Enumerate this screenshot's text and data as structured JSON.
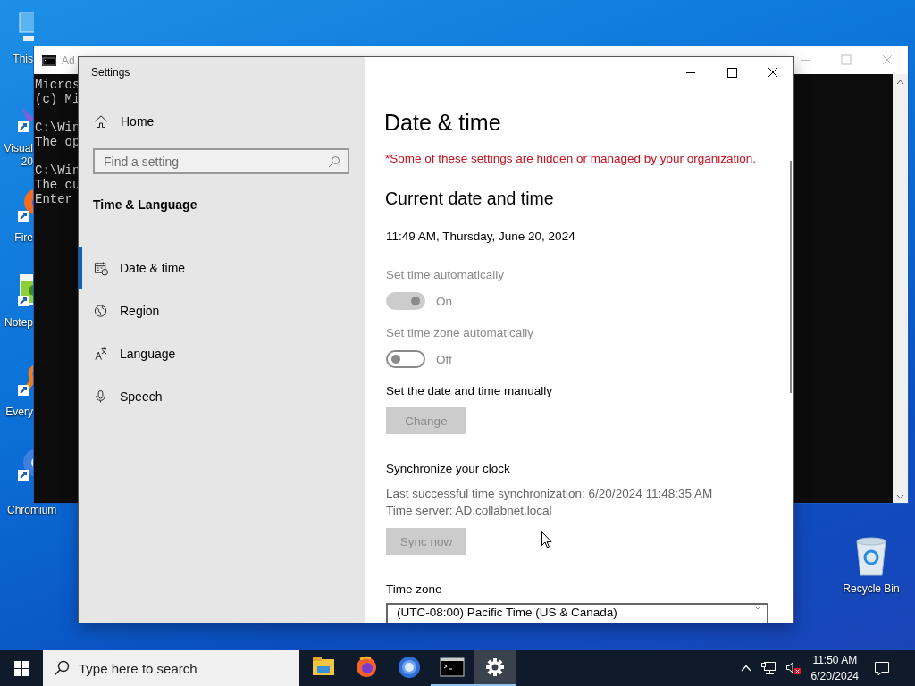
{
  "desktop_icons": [
    {
      "kind": "computer",
      "label": "This"
    },
    {
      "kind": "studio",
      "label": "Visual 20"
    },
    {
      "kind": "firefox",
      "label": "Fire"
    },
    {
      "kind": "notepad",
      "label": "Notep"
    },
    {
      "kind": "everything",
      "label": "Every"
    },
    {
      "kind": "chromium",
      "label": "Chromium"
    }
  ],
  "recycle_bin": {
    "label": "Recycle Bin"
  },
  "console": {
    "title": "Ad",
    "blocks": [
      [
        "Micros",
        "(c) Mi"
      ],
      [
        "C:\\Win",
        "The op"
      ],
      [
        "C:\\Win",
        "The cu",
        "Enter"
      ]
    ]
  },
  "settings": {
    "title": "Settings",
    "nav": {
      "home": "Home",
      "search": {
        "placeholder": "Find a setting"
      },
      "section": "Time & Language",
      "items": [
        {
          "kind": "date",
          "label": "Date & time",
          "selected": true
        },
        {
          "kind": "region",
          "label": "Region",
          "selected": false
        },
        {
          "kind": "language",
          "label": "Language",
          "selected": false
        },
        {
          "kind": "speech",
          "label": "Speech",
          "selected": false
        }
      ]
    },
    "page": {
      "title": "Date & time",
      "notice": "*Some of these settings are hidden or managed by your organization.",
      "section_title": "Current date and time",
      "current": "11:49 AM, Thursday, June 20, 2024",
      "items": [
        {
          "kind": "toggle",
          "label": "Set time automatically",
          "on": true,
          "disabled": true,
          "state_text": "On"
        },
        {
          "kind": "toggle",
          "label": "Set time zone automatically",
          "on": false,
          "disabled": true,
          "state_text": "Off"
        },
        {
          "kind": "button",
          "label": "Set the date and time manually",
          "button": "Change",
          "disabled": true
        },
        {
          "kind": "sync",
          "label": "Synchronize your clock",
          "lines": [
            "Last successful time synchronization: 6/20/2024 11:48:35 AM",
            "Time server: AD.collabnet.local"
          ],
          "button": "Sync now",
          "disabled": true
        },
        {
          "kind": "dropdown",
          "label": "Time zone",
          "value": "(UTC-08:00) Pacific Time (US & Canada)"
        }
      ]
    }
  },
  "taskbar": {
    "search": {
      "placeholder": "Type here to search"
    },
    "apps": [
      {
        "kind": "folder",
        "selected": false,
        "open": false
      },
      {
        "kind": "firefox",
        "selected": false,
        "open": false
      },
      {
        "kind": "chromium",
        "selected": false,
        "open": false
      },
      {
        "kind": "terminal",
        "selected": false,
        "open": true
      },
      {
        "kind": "settings",
        "selected": true,
        "open": true
      }
    ],
    "tray": {
      "volume_muted": true,
      "time": "11:50 AM",
      "date": "6/20/2024"
    }
  }
}
